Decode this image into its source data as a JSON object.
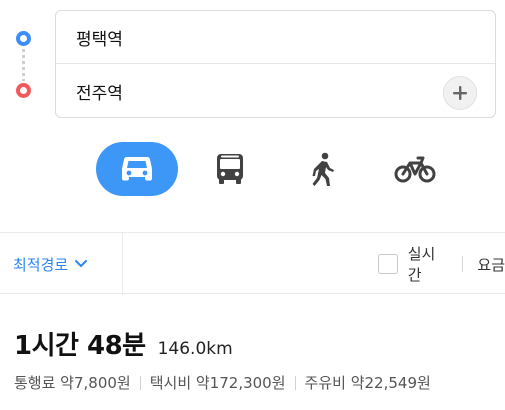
{
  "route": {
    "origin": "평택역",
    "destination": "전주역"
  },
  "modes": [
    {
      "name": "car",
      "icon": "car-icon",
      "active": true
    },
    {
      "name": "bus",
      "icon": "bus-icon",
      "active": false
    },
    {
      "name": "walk",
      "icon": "walk-icon",
      "active": false
    },
    {
      "name": "bike",
      "icon": "bike-icon",
      "active": false
    }
  ],
  "options": {
    "sort_label": "최적경로",
    "realtime_label": "실시간",
    "fee_tab_label": "요금"
  },
  "summary": {
    "duration": "1시간 48분",
    "distance": "146.0km"
  },
  "fees": {
    "toll": "통행료 약7,800원",
    "taxi": "택시비 약172,300원",
    "fuel": "주유비 약22,549원"
  },
  "colors": {
    "accent": "#3d97f7",
    "origin_dot": "#3a8ef6",
    "destination_dot": "#f05a5a",
    "sort_text": "#2b86f0"
  }
}
